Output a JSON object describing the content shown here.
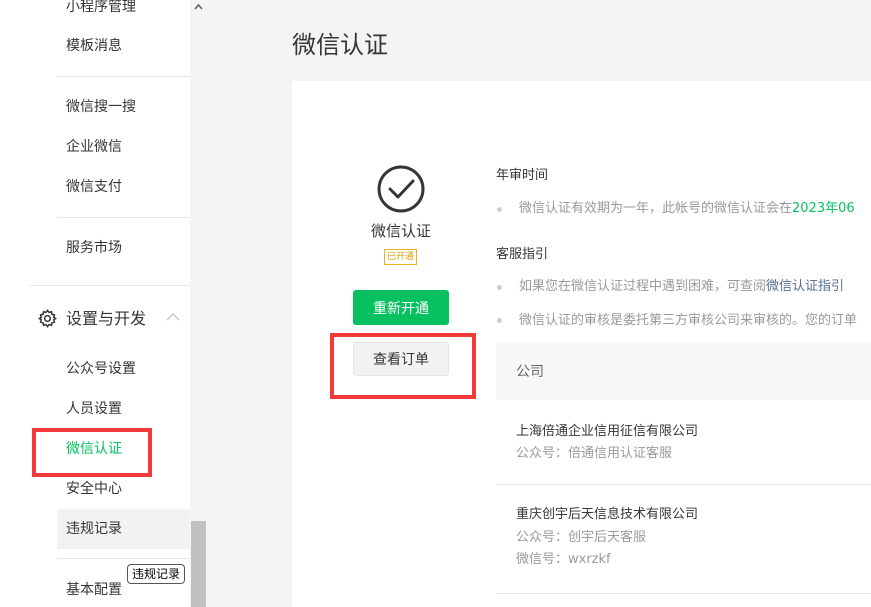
{
  "sidebar": {
    "items": [
      {
        "label": "小程序管理"
      },
      {
        "label": "模板消息"
      },
      {
        "label": "微信搜一搜"
      },
      {
        "label": "企业微信"
      },
      {
        "label": "微信支付"
      },
      {
        "label": "服务市场"
      },
      {
        "label": "公众号设置"
      },
      {
        "label": "人员设置"
      },
      {
        "label": "微信认证"
      },
      {
        "label": "安全中心"
      },
      {
        "label": "违规记录"
      },
      {
        "label": "基本配置"
      }
    ],
    "section": {
      "label": "设置与开发",
      "icon": "gear-icon",
      "state": "expanded"
    },
    "active_item": "微信认证",
    "tooltip": "违规记录"
  },
  "page": {
    "title": "微信认证"
  },
  "certification": {
    "icon": "check-circle-icon",
    "label": "微信认证",
    "status_badge": "已开通",
    "renew_button": "重新开通",
    "view_orders_button": "查看订单"
  },
  "annual_review": {
    "heading": "年审时间",
    "text": "微信认证有效期为一年，此帐号的微信认证会在",
    "date": "2023年06"
  },
  "support": {
    "heading": "客服指引",
    "line1_text": "如果您在微信认证过程中遇到困难，可查阅",
    "line1_link": "微信认证指引",
    "line2_text": "微信认证的审核是委托第三方审核公司来审核的。您的订单"
  },
  "companies": {
    "header": "公司",
    "rows": [
      {
        "name": "上海倍通企业信用征信有限公司",
        "account": "公众号：倍通信用认证客服"
      },
      {
        "name": "重庆创宇后天信息技术有限公司",
        "account": "公众号：创宇后天客服",
        "wechat_id": "微信号：wxrzkf"
      }
    ]
  },
  "colors": {
    "accent": "#07c160",
    "highlight_box": "#f23a3a",
    "badge": "#d9a300",
    "link": "#576b95"
  }
}
